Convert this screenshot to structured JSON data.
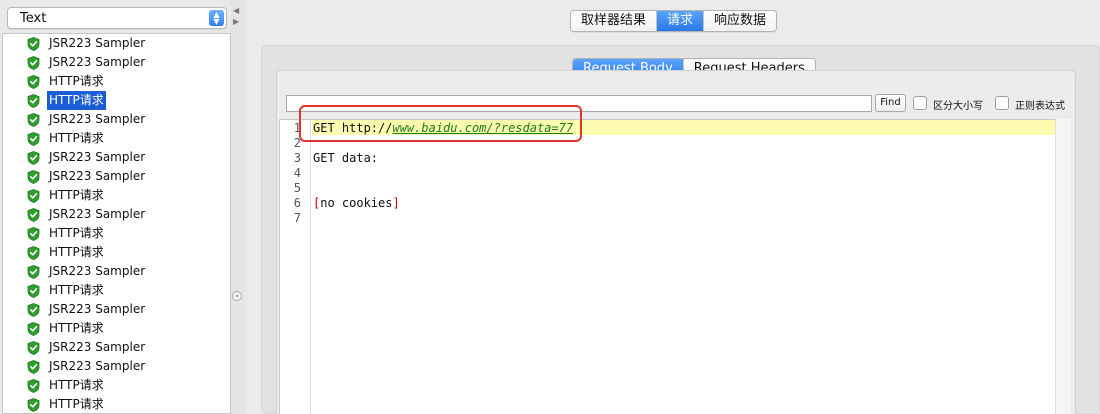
{
  "left_panel": {
    "view_select": {
      "value": "Text"
    },
    "tree_items": [
      {
        "label": "JSR223 Sampler",
        "selected": false
      },
      {
        "label": "JSR223 Sampler",
        "selected": false
      },
      {
        "label": "HTTP请求",
        "selected": false
      },
      {
        "label": "HTTP请求",
        "selected": true
      },
      {
        "label": "JSR223 Sampler",
        "selected": false
      },
      {
        "label": "HTTP请求",
        "selected": false
      },
      {
        "label": "JSR223 Sampler",
        "selected": false
      },
      {
        "label": "JSR223 Sampler",
        "selected": false
      },
      {
        "label": "HTTP请求",
        "selected": false
      },
      {
        "label": "JSR223 Sampler",
        "selected": false
      },
      {
        "label": "HTTP请求",
        "selected": false
      },
      {
        "label": "HTTP请求",
        "selected": false
      },
      {
        "label": "JSR223 Sampler",
        "selected": false
      },
      {
        "label": "HTTP请求",
        "selected": false
      },
      {
        "label": "JSR223 Sampler",
        "selected": false
      },
      {
        "label": "HTTP请求",
        "selected": false
      },
      {
        "label": "JSR223 Sampler",
        "selected": false
      },
      {
        "label": "JSR223 Sampler",
        "selected": false
      },
      {
        "label": "HTTP请求",
        "selected": false
      },
      {
        "label": "HTTP请求",
        "selected": false
      }
    ],
    "status_icon": "green-shield-check-icon"
  },
  "top_tabs": [
    {
      "label": "取样器结果",
      "active": false
    },
    {
      "label": "请求",
      "active": true
    },
    {
      "label": "响应数据",
      "active": false
    }
  ],
  "inner_tabs": [
    {
      "label": "Request Body",
      "active": true
    },
    {
      "label": "Request Headers",
      "active": false
    }
  ],
  "search": {
    "value": "",
    "find_label": "Find",
    "case_sensitive_label": "区分大小写",
    "regex_label": "正则表达式"
  },
  "editor": {
    "line_numbers": [
      "1",
      "2",
      "3",
      "4",
      "5",
      "6",
      "7"
    ],
    "line1_prefix": "GET http://",
    "line1_url": "www.baidu.com/?resdata=77",
    "line3": "GET data:",
    "line6_open": "[",
    "line6_text": "no cookies",
    "line6_close": "]"
  },
  "colors": {
    "selection": "#1a5dd6",
    "active_tab": "#2a78ea",
    "current_line": "#fdfbb0",
    "url": "#1c7d18",
    "annotation_box": "#e5332f"
  }
}
